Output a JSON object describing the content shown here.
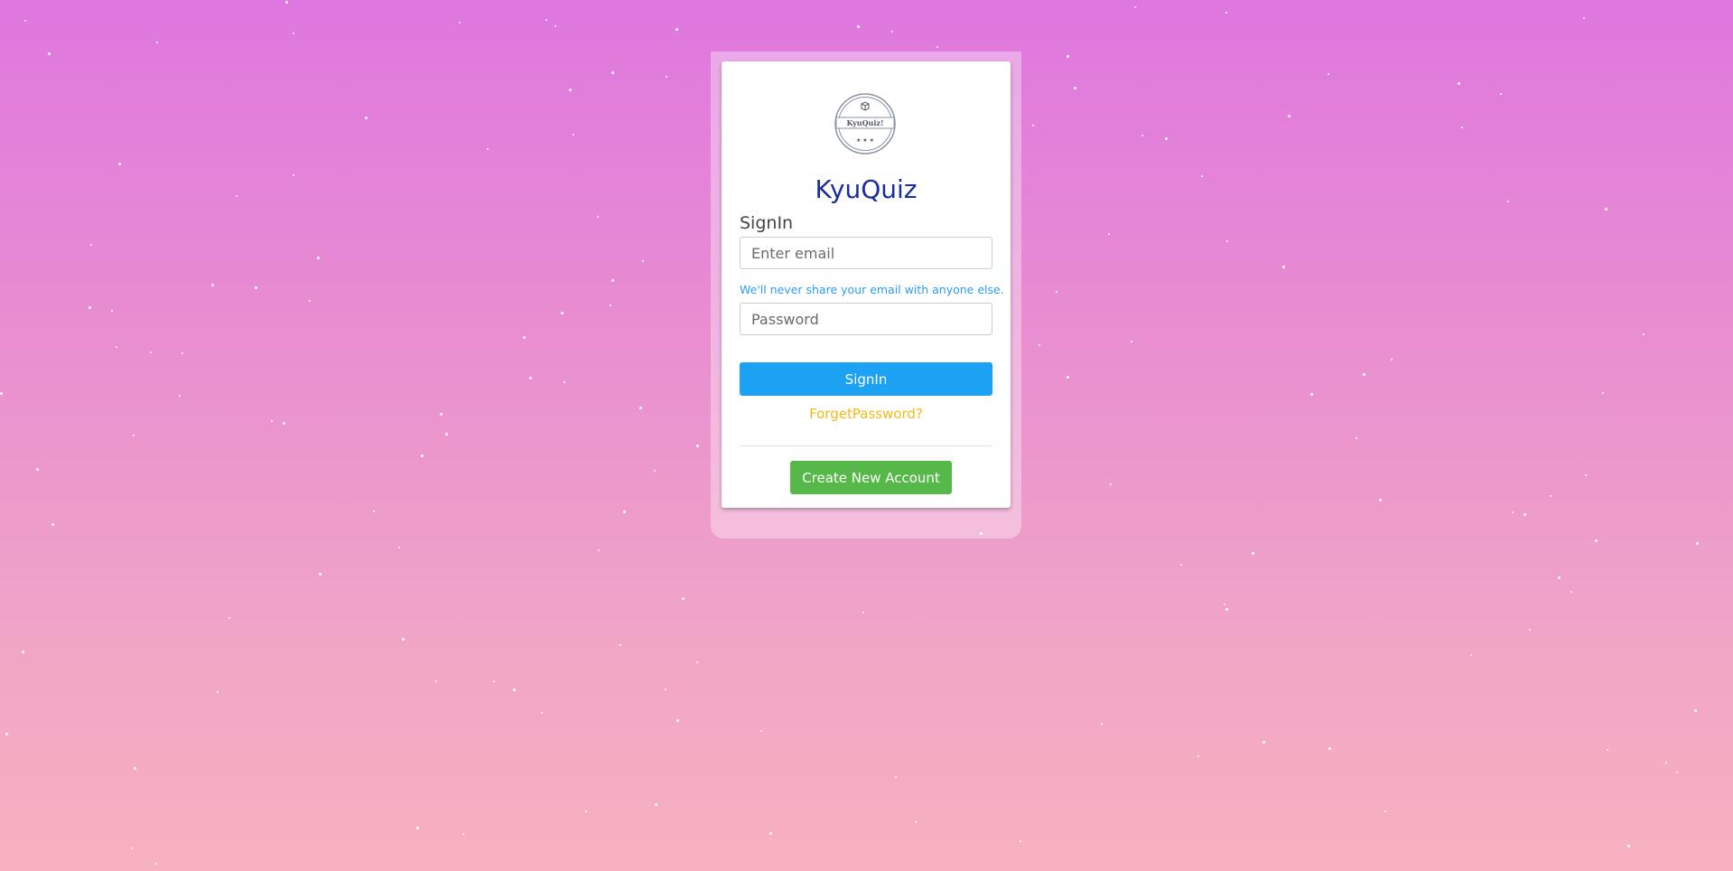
{
  "app": {
    "title": "KyuQuiz",
    "logo_text": "KyuQuiz!"
  },
  "form": {
    "heading": "SignIn",
    "email_placeholder": "Enter email",
    "email_help": "We'll never share your email with anyone else.",
    "password_placeholder": "Password",
    "signin_label": "SignIn",
    "forgot_label": "ForgetPassword?",
    "create_label": "Create New Account"
  },
  "colors": {
    "title": "#1a2f9b",
    "signin": "#1da1f2",
    "forgot": "#f5b914",
    "create": "#56b848",
    "help": "#2a9df4"
  }
}
